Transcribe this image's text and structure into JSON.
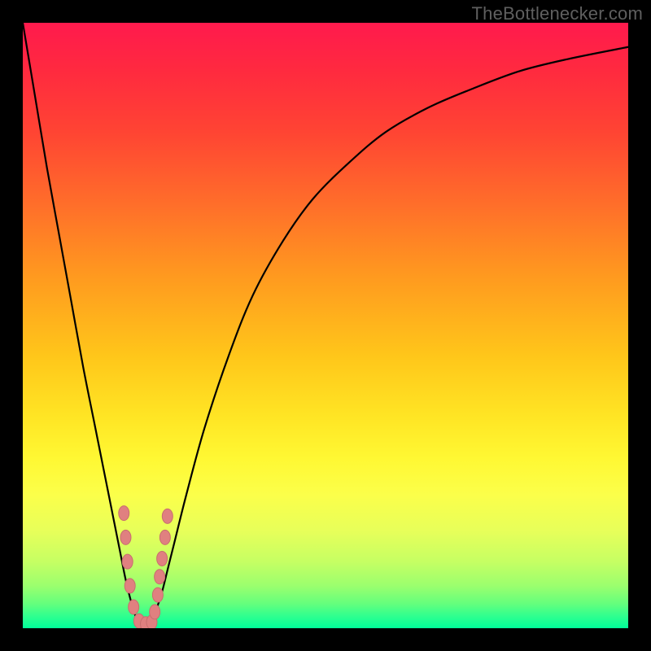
{
  "watermark": "TheBottlenecker.com",
  "chart_data": {
    "type": "line",
    "title": "",
    "xlabel": "",
    "ylabel": "",
    "xlim": [
      0,
      100
    ],
    "ylim": [
      0,
      100
    ],
    "x_notch": 20,
    "series": [
      {
        "name": "bottleneck-curve",
        "x": [
          0,
          2,
          4,
          6,
          8,
          10,
          12,
          14,
          16,
          17,
          18,
          19,
          20,
          21,
          22,
          23,
          24,
          25,
          27,
          30,
          34,
          38,
          43,
          48,
          54,
          60,
          67,
          74,
          82,
          90,
          100
        ],
        "y": [
          100,
          88,
          76,
          65,
          54,
          43,
          33,
          23,
          13,
          8,
          4,
          1,
          0,
          1,
          3,
          6,
          10,
          14,
          22,
          33,
          45,
          55,
          64,
          71,
          77,
          82,
          86,
          89,
          92,
          94,
          96
        ]
      }
    ],
    "markers": {
      "name": "sample-points",
      "points": [
        {
          "x": 16.7,
          "y": 19
        },
        {
          "x": 17.0,
          "y": 15
        },
        {
          "x": 17.3,
          "y": 11
        },
        {
          "x": 17.7,
          "y": 7
        },
        {
          "x": 18.3,
          "y": 3.5
        },
        {
          "x": 19.2,
          "y": 1.2
        },
        {
          "x": 20.3,
          "y": 0.7
        },
        {
          "x": 21.3,
          "y": 1.0
        },
        {
          "x": 21.8,
          "y": 2.7
        },
        {
          "x": 22.3,
          "y": 5.5
        },
        {
          "x": 22.6,
          "y": 8.5
        },
        {
          "x": 23.0,
          "y": 11.5
        },
        {
          "x": 23.5,
          "y": 15
        },
        {
          "x": 23.9,
          "y": 18.5
        }
      ]
    }
  }
}
